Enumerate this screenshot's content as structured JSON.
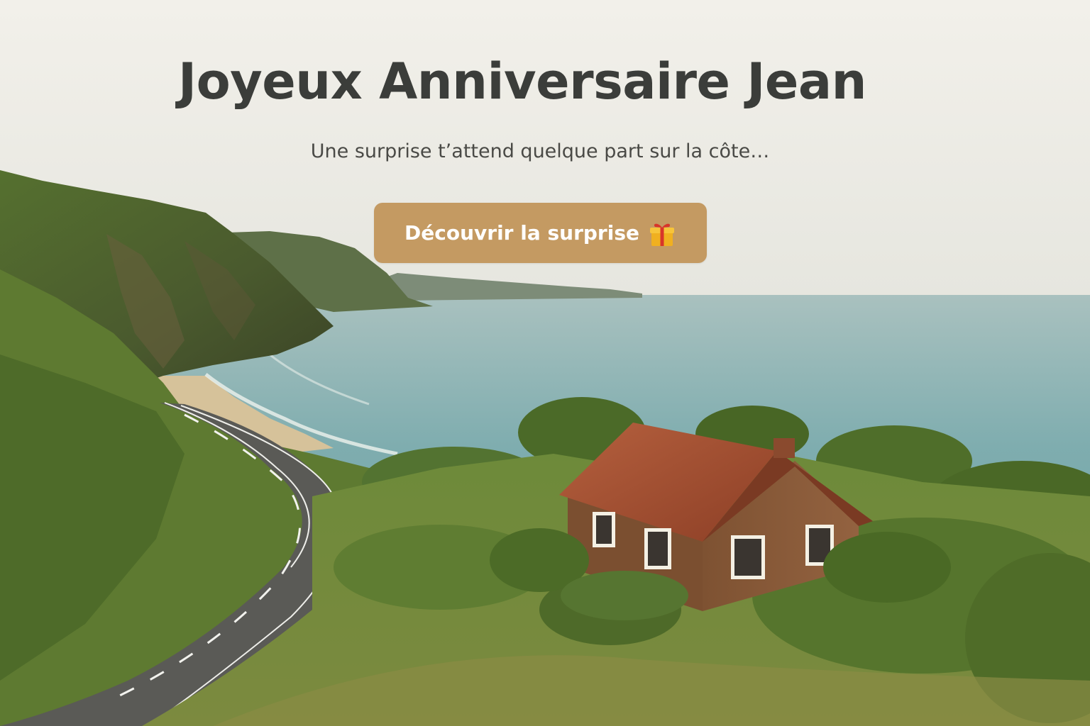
{
  "hero": {
    "title": "Joyeux Anniversaire Jean",
    "subtitle": "Une surprise t’attend quelque part sur la côte…",
    "cta_label": "Découvrir la surprise",
    "cta_icon": "gift-icon"
  },
  "colors": {
    "background": "#f1efe9",
    "title": "#3b3d3a",
    "button": "#c49a62",
    "button_text": "#ffffff"
  }
}
